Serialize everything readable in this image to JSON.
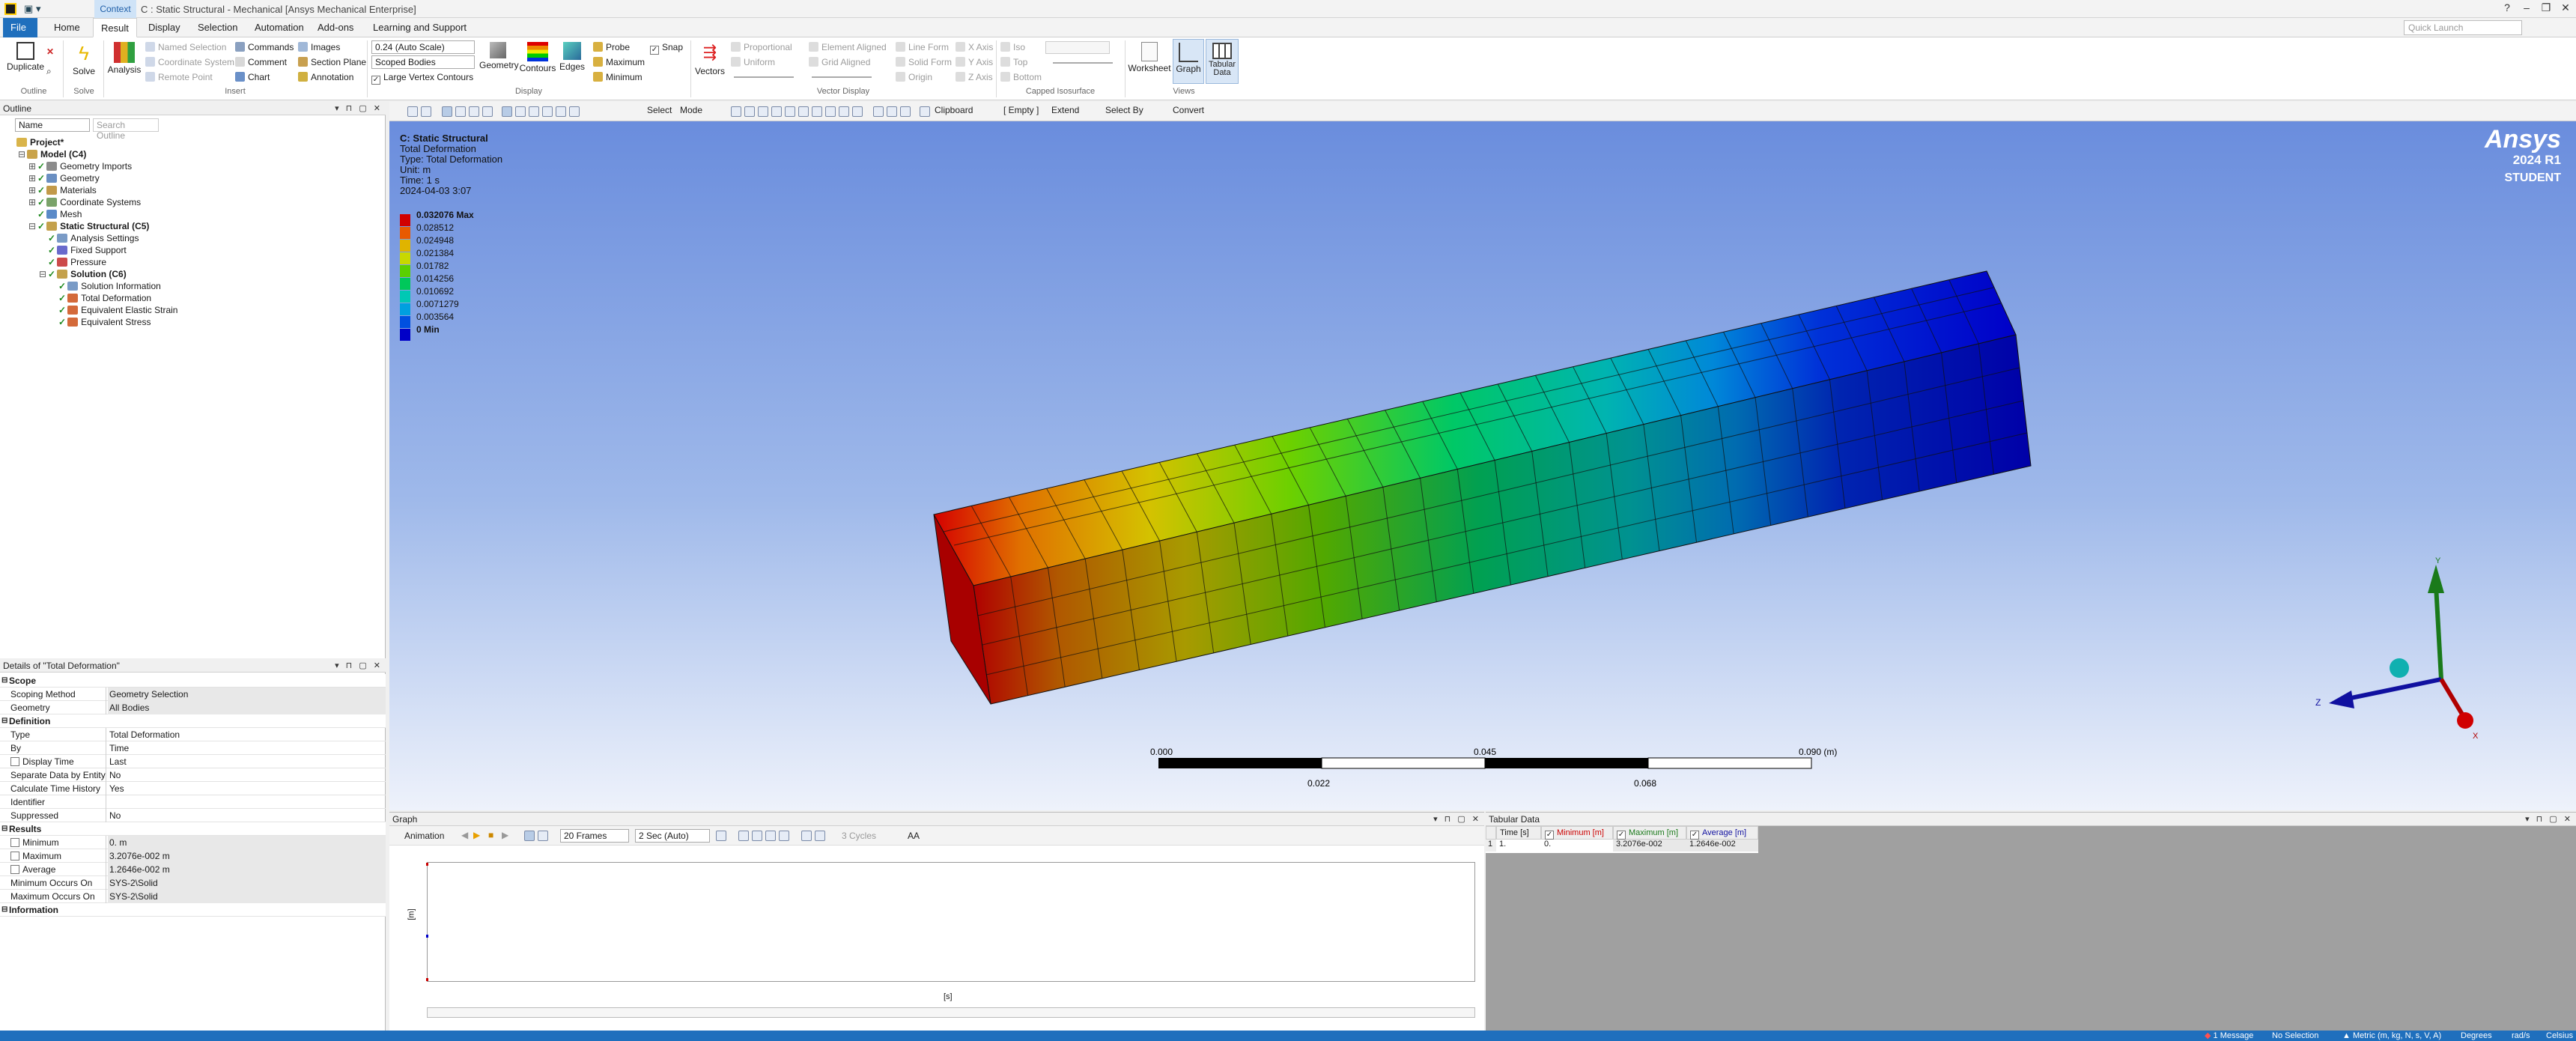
{
  "titlebar": {
    "context_tab": "Context",
    "window_title": "C : Static Structural - Mechanical [Ansys Mechanical Enterprise]",
    "window_controls": [
      "?",
      "–",
      "❐",
      "✕"
    ]
  },
  "menu": {
    "tabs": [
      "File",
      "Home",
      "Result",
      "Display",
      "Selection",
      "Automation",
      "Add-ons",
      "Learning and Support"
    ],
    "active": "Result",
    "quick_launch_placeholder": "Quick Launch"
  },
  "ribbon": {
    "outline": {
      "duplicate": "Duplicate",
      "group": "Outline"
    },
    "solve": {
      "solve": "Solve",
      "group": "Solve"
    },
    "insert": {
      "analysis": "Analysis",
      "named_selection": "Named Selection",
      "coordinate_system": "Coordinate System",
      "remote_point": "Remote Point",
      "commands": "Commands",
      "comment": "Comment",
      "chart": "Chart",
      "images": "Images",
      "section_plane": "Section Plane",
      "annotation": "Annotation",
      "group": "Insert"
    },
    "display": {
      "scale_combo": "0.24 (Auto Scale)",
      "bodies_combo": "Scoped Bodies",
      "large_vertex": "Large Vertex Contours",
      "geometry": "Geometry",
      "contours": "Contours",
      "edges": "Edges",
      "probe": "Probe",
      "maximum": "Maximum",
      "minimum": "Minimum",
      "snap": "Snap",
      "group": "Display"
    },
    "vector": {
      "vectors": "Vectors",
      "proportional": "Proportional",
      "uniform": "Uniform",
      "element_aligned": "Element Aligned",
      "grid_aligned": "Grid Aligned",
      "line_form": "Line Form",
      "solid_form": "Solid Form",
      "origin": "Origin",
      "x_axis": "X Axis",
      "y_axis": "Y Axis",
      "z_axis": "Z Axis",
      "group": "Vector Display"
    },
    "capped": {
      "iso": "Iso",
      "top": "Top",
      "bottom": "Bottom",
      "group": "Capped Isosurface"
    },
    "views": {
      "worksheet": "Worksheet",
      "graph": "Graph",
      "tabular": "Tabular Data",
      "group": "Views"
    }
  },
  "outline": {
    "title": "Outline",
    "filter_combo": "Name",
    "search_placeholder": "Search Outline",
    "items": [
      {
        "label": "Project*",
        "level": 0,
        "bold": true,
        "expand": "",
        "check": false,
        "icon": "#d9b44a"
      },
      {
        "label": "Model (C4)",
        "level": 1,
        "bold": true,
        "expand": "⊟",
        "check": false,
        "icon": "#c9a34a"
      },
      {
        "label": "Geometry Imports",
        "level": 2,
        "bold": false,
        "expand": "⊞",
        "check": true,
        "icon": "#8c8c8c"
      },
      {
        "label": "Geometry",
        "level": 2,
        "bold": false,
        "expand": "⊞",
        "check": true,
        "icon": "#6a8fc2"
      },
      {
        "label": "Materials",
        "level": 2,
        "bold": false,
        "expand": "⊞",
        "check": true,
        "icon": "#c29a4a"
      },
      {
        "label": "Coordinate Systems",
        "level": 2,
        "bold": false,
        "expand": "⊞",
        "check": true,
        "icon": "#7aa36a"
      },
      {
        "label": "Mesh",
        "level": 2,
        "bold": false,
        "expand": "",
        "check": true,
        "icon": "#5a8ac8"
      },
      {
        "label": "Static Structural (C5)",
        "level": 2,
        "bold": true,
        "expand": "⊟",
        "check": true,
        "icon": "#c4a14c"
      },
      {
        "label": "Analysis Settings",
        "level": 3,
        "bold": false,
        "expand": "",
        "check": true,
        "icon": "#7a9bc6"
      },
      {
        "label": "Fixed Support",
        "level": 3,
        "bold": false,
        "expand": "",
        "check": true,
        "icon": "#6a6acc"
      },
      {
        "label": "Pressure",
        "level": 3,
        "bold": false,
        "expand": "",
        "check": true,
        "icon": "#cc4a4a"
      },
      {
        "label": "Solution (C6)",
        "level": 3,
        "bold": true,
        "expand": "⊟",
        "check": true,
        "icon": "#c4a14c"
      },
      {
        "label": "Solution Information",
        "level": 4,
        "bold": false,
        "expand": "",
        "check": true,
        "icon": "#7a9bc6"
      },
      {
        "label": "Total Deformation",
        "level": 4,
        "bold": false,
        "expand": "",
        "check": true,
        "icon": "#d46a3a"
      },
      {
        "label": "Equivalent Elastic Strain",
        "level": 4,
        "bold": false,
        "expand": "",
        "check": true,
        "icon": "#d46a3a"
      },
      {
        "label": "Equivalent Stress",
        "level": 4,
        "bold": false,
        "expand": "",
        "check": true,
        "icon": "#d46a3a"
      }
    ]
  },
  "details": {
    "title": "Details of \"Total Deformation\"",
    "rows": [
      {
        "type": "sec",
        "key": "Scope"
      },
      {
        "type": "row",
        "key": "Scoping Method",
        "value": "Geometry Selection",
        "hl": true
      },
      {
        "type": "row",
        "key": "Geometry",
        "value": "All Bodies",
        "hl": true
      },
      {
        "type": "sec",
        "key": "Definition"
      },
      {
        "type": "row",
        "key": "Type",
        "value": "Total Deformation",
        "hl": false
      },
      {
        "type": "row",
        "key": "By",
        "value": "Time",
        "hl": false
      },
      {
        "type": "row",
        "key": "Display Time",
        "value": "Last",
        "hl": false,
        "check": true
      },
      {
        "type": "row",
        "key": "Separate Data by Entity",
        "value": "No",
        "hl": false
      },
      {
        "type": "row",
        "key": "Calculate Time History",
        "value": "Yes",
        "hl": false
      },
      {
        "type": "row",
        "key": "Identifier",
        "value": "",
        "hl": false
      },
      {
        "type": "row",
        "key": "Suppressed",
        "value": "No",
        "hl": false
      },
      {
        "type": "sec",
        "key": "Results"
      },
      {
        "type": "row",
        "key": "Minimum",
        "value": "0. m",
        "hl": true,
        "check": true
      },
      {
        "type": "row",
        "key": "Maximum",
        "value": "3.2076e-002 m",
        "hl": true,
        "check": true
      },
      {
        "type": "row",
        "key": "Average",
        "value": "1.2646e-002 m",
        "hl": true,
        "check": true
      },
      {
        "type": "row",
        "key": "Minimum Occurs On",
        "value": "SYS-2\\Solid",
        "hl": true
      },
      {
        "type": "row",
        "key": "Maximum Occurs On",
        "value": "SYS-2\\Solid",
        "hl": true
      },
      {
        "type": "sec",
        "key": "Information"
      }
    ]
  },
  "viewport_toolbar": {
    "select": "Select",
    "mode": "Mode",
    "clipboard": "Clipboard",
    "empty": "[ Empty ]",
    "extend": "Extend",
    "select_by": "Select By",
    "convert": "Convert"
  },
  "result_info": {
    "title": "C: Static Structural",
    "lines": [
      "Total Deformation",
      "Type: Total Deformation",
      "Unit: m",
      "Time: 1 s",
      "2024-04-03 3:07"
    ]
  },
  "legend": {
    "entries": [
      {
        "label": "0.032076 Max",
        "color": "#d10000",
        "bold": true
      },
      {
        "label": "0.028512",
        "color": "#e85a00"
      },
      {
        "label": "0.024948",
        "color": "#e0b400"
      },
      {
        "label": "0.021384",
        "color": "#c8d800"
      },
      {
        "label": "0.01782",
        "color": "#5ad000"
      },
      {
        "label": "0.014256",
        "color": "#00c85a"
      },
      {
        "label": "0.010692",
        "color": "#00c8b4"
      },
      {
        "label": "0.0071279",
        "color": "#00a0e0"
      },
      {
        "label": "0.003564",
        "color": "#0050e0"
      },
      {
        "label": "0 Min",
        "color": "#0000c8",
        "bold": true
      }
    ]
  },
  "brand": {
    "name": "Ansys",
    "version": "2024 R1",
    "edition": "STUDENT"
  },
  "scale_bar": {
    "top_labels": [
      "0.000",
      "0.045",
      "0.090 (m)"
    ],
    "bottom_labels": [
      "0.022",
      "0.068"
    ]
  },
  "triad": {
    "x": "X",
    "y": "Y",
    "z": "Z"
  },
  "graph": {
    "title": "Graph",
    "animation": "Animation",
    "frames": "20 Frames",
    "duration": "2 Sec (Auto)",
    "cycles": "3 Cycles",
    "aa": "AA",
    "ylabel": "[m]",
    "xlabel": "[s]"
  },
  "tabular": {
    "title": "Tabular Data",
    "headers": [
      "Time [s]",
      "Minimum [m]",
      "Maximum [m]",
      "Average [m]"
    ],
    "rows": [
      [
        "1",
        "1.",
        "0.",
        "3.2076e-002",
        "1.2646e-002"
      ]
    ]
  },
  "statusbar": {
    "messages": "1 Message",
    "selection": "No Selection",
    "units": "Metric (m, kg, N, s, V, A)",
    "angle": "Degrees",
    "rate": "rad/s",
    "temp": "Celsius"
  }
}
